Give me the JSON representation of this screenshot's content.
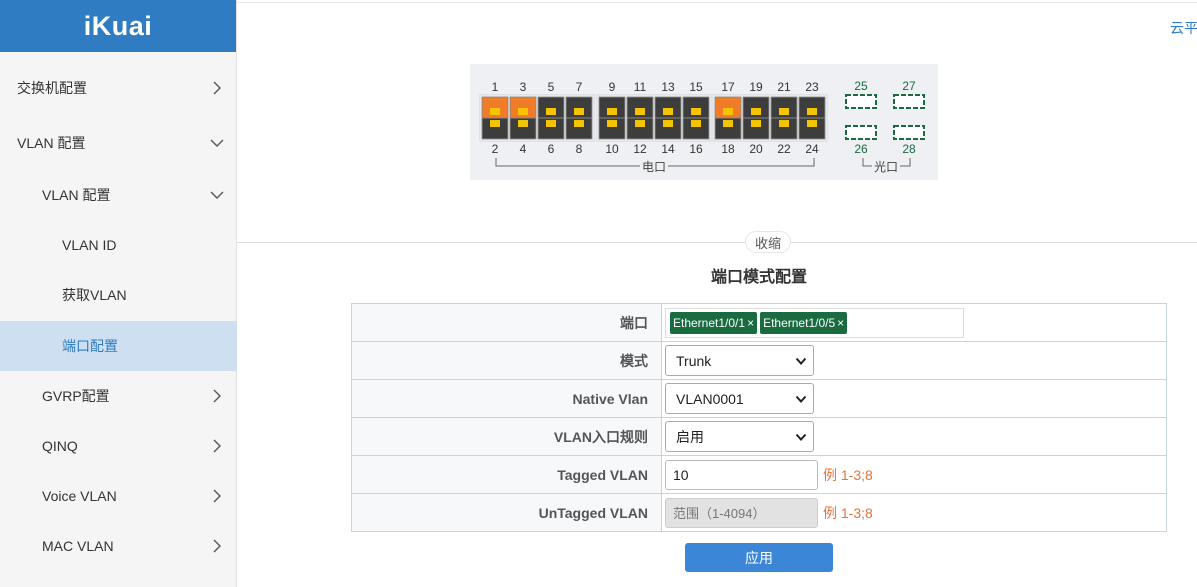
{
  "brand": {
    "logo_text": "iKuai"
  },
  "header": {
    "right_text": "云平"
  },
  "sidebar": {
    "items": [
      {
        "label": "交换机配置",
        "expanded": false
      },
      {
        "label": "VLAN 配置",
        "expanded": true
      },
      {
        "label": "VLAN 配置",
        "expanded": true
      },
      {
        "label": "VLAN ID"
      },
      {
        "label": "获取VLAN"
      },
      {
        "label": "端口配置",
        "active": true
      },
      {
        "label": "GVRP配置",
        "expanded": false
      },
      {
        "label": "QINQ",
        "expanded": false
      },
      {
        "label": "Voice VLAN",
        "expanded": false
      },
      {
        "label": "MAC VLAN",
        "expanded": false
      }
    ]
  },
  "switch_panel": {
    "top_ports": [
      "1",
      "3",
      "5",
      "7",
      "9",
      "11",
      "13",
      "15",
      "17",
      "19",
      "21",
      "23"
    ],
    "bottom_ports": [
      "2",
      "4",
      "6",
      "8",
      "10",
      "12",
      "14",
      "16",
      "18",
      "20",
      "22",
      "24"
    ],
    "active_ports": [
      "1",
      "3",
      "17"
    ],
    "fiber_top": [
      "25",
      "27"
    ],
    "fiber_bottom": [
      "26",
      "28"
    ],
    "electric_label": "电口",
    "fiber_label": "光口",
    "colors": {
      "port_dark": "#3d3d3d",
      "port_active": "#f07c2a",
      "led": "#f5c400",
      "fiber_border": "#1a6b3f"
    }
  },
  "collapse_label": "收缩",
  "form": {
    "title": "端口模式配置",
    "port_label": "端口",
    "port_tags": [
      "Ethernet1/0/1",
      "Ethernet1/0/5"
    ],
    "mode_label": "模式",
    "mode_value": "Trunk",
    "native_vlan_label": "Native Vlan",
    "native_vlan_value": "VLAN0001",
    "ingress_label": "VLAN入口规则",
    "ingress_value": "启用",
    "tagged_label": "Tagged VLAN",
    "tagged_value": "10",
    "tagged_hint": "例 1-3;8",
    "untagged_label": "UnTagged VLAN",
    "untagged_placeholder": "范围（1-4094）",
    "untagged_hint": "例 1-3;8",
    "apply_label": "应用"
  }
}
